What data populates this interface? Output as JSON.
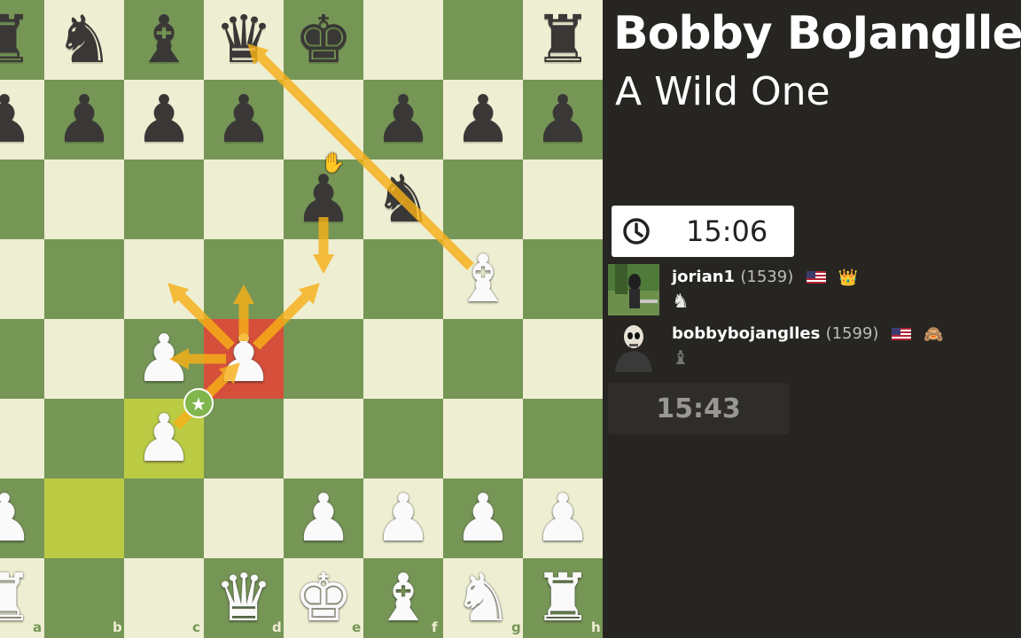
{
  "title": "Bobby BoJanglles",
  "subtitle": "A Wild One",
  "clocks": {
    "top": "15:06",
    "bottom": "15:43"
  },
  "players": [
    {
      "name": "jorian1",
      "rating": "(1539)",
      "flag": "us-flag-icon",
      "badge": "crown-badge-icon",
      "captured": "♞"
    },
    {
      "name": "bobbybojanglles",
      "rating": "(1599)",
      "flag": "us-flag-icon",
      "badge": "avatar-badge-icon",
      "captured": "♝"
    }
  ],
  "board": {
    "colors": {
      "light": "#eeeed2",
      "dark": "#769656",
      "highlight": "#d64f3a",
      "arrow": "#f5b018"
    },
    "file_labels": [
      "a",
      "b",
      "c",
      "d",
      "e",
      "f",
      "g",
      "h"
    ],
    "pieces": [
      {
        "sq": "a8",
        "p": "♜",
        "c": "b"
      },
      {
        "sq": "b8",
        "p": "♞",
        "c": "b"
      },
      {
        "sq": "c8",
        "p": "♝",
        "c": "b"
      },
      {
        "sq": "d8",
        "p": "♛",
        "c": "b"
      },
      {
        "sq": "e8",
        "p": "♚",
        "c": "b"
      },
      {
        "sq": "h8",
        "p": "♜",
        "c": "b"
      },
      {
        "sq": "a7",
        "p": "♟",
        "c": "b"
      },
      {
        "sq": "b7",
        "p": "♟",
        "c": "b"
      },
      {
        "sq": "c7",
        "p": "♟",
        "c": "b"
      },
      {
        "sq": "d7",
        "p": "♟",
        "c": "b"
      },
      {
        "sq": "f7",
        "p": "♟",
        "c": "b"
      },
      {
        "sq": "g7",
        "p": "♟",
        "c": "b"
      },
      {
        "sq": "h7",
        "p": "♟",
        "c": "b"
      },
      {
        "sq": "e6",
        "p": "♟",
        "c": "b"
      },
      {
        "sq": "f6",
        "p": "♞",
        "c": "b"
      },
      {
        "sq": "g5",
        "p": "♝",
        "c": "w"
      },
      {
        "sq": "c4",
        "p": "♟",
        "c": "w"
      },
      {
        "sq": "d4",
        "p": "♟",
        "c": "w"
      },
      {
        "sq": "c3",
        "p": "♟",
        "c": "w"
      },
      {
        "sq": "a2",
        "p": "♟",
        "c": "w"
      },
      {
        "sq": "e2",
        "p": "♟",
        "c": "w"
      },
      {
        "sq": "f2",
        "p": "♟",
        "c": "w"
      },
      {
        "sq": "g2",
        "p": "♟",
        "c": "w"
      },
      {
        "sq": "h2",
        "p": "♟",
        "c": "w"
      },
      {
        "sq": "a1",
        "p": "♜",
        "c": "w"
      },
      {
        "sq": "d1",
        "p": "♛",
        "c": "w"
      },
      {
        "sq": "e1",
        "p": "♚",
        "c": "w"
      },
      {
        "sq": "f1",
        "p": "♝",
        "c": "w"
      },
      {
        "sq": "g1",
        "p": "♞",
        "c": "w"
      },
      {
        "sq": "h1",
        "p": "♜",
        "c": "w"
      }
    ],
    "highlight_square": "d4",
    "highlighted_green": [
      "b2",
      "c3"
    ],
    "arrows": [
      {
        "from": "g5",
        "to": "d8"
      },
      {
        "from": "e6",
        "to": "e5"
      },
      {
        "from": "d4",
        "to": "c5"
      },
      {
        "from": "d4",
        "to": "d5"
      },
      {
        "from": "d4",
        "to": "e5"
      },
      {
        "from": "d4",
        "to": "c4"
      },
      {
        "from": "c3",
        "to": "d4"
      }
    ]
  }
}
